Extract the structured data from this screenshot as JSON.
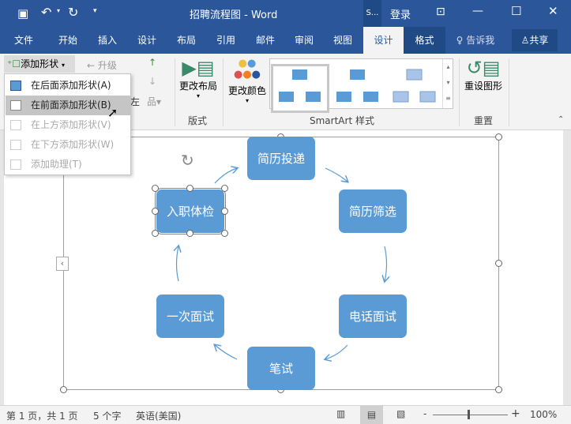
{
  "titlebar": {
    "title": "招聘流程图  -  Word",
    "account_short": "S...",
    "login": "登录",
    "qat_icons": [
      "save-icon",
      "undo-icon",
      "redo-icon",
      "customize-icon"
    ]
  },
  "tabs": [
    {
      "label": "文件"
    },
    {
      "label": "开始"
    },
    {
      "label": "插入"
    },
    {
      "label": "设计"
    },
    {
      "label": "布局"
    },
    {
      "label": "引用"
    },
    {
      "label": "邮件"
    },
    {
      "label": "审阅"
    },
    {
      "label": "视图"
    },
    {
      "label": "设计",
      "active": true
    },
    {
      "label": "格式"
    }
  ],
  "tell_me": "告诉我",
  "share": "共享",
  "ribbon": {
    "add_shape": "添加形状",
    "promote": "升级",
    "rtl_partial": "左",
    "change_layout": "更改布局",
    "change_colors": "更改颜色",
    "reset_graphic": "重设图形",
    "groups": {
      "layouts": "版式",
      "styles": "SmartArt 样式",
      "reset": "重置"
    }
  },
  "menu": [
    {
      "label": "在后面添加形状(A)",
      "enabled": true
    },
    {
      "label": "在前面添加形状(B)",
      "enabled": true,
      "highlighted": true
    },
    {
      "label": "在上方添加形状(V)",
      "enabled": false
    },
    {
      "label": "在下方添加形状(W)",
      "enabled": false
    },
    {
      "label": "添加助理(T)",
      "enabled": false
    }
  ],
  "smartart": {
    "color": "#5b9bd5",
    "nodes": [
      "简历投递",
      "简历筛选",
      "电话面试",
      "笔试",
      "一次面试",
      "入职体检"
    ],
    "selected": "入职体检"
  },
  "status": {
    "page": "第 1 页，共 1 页",
    "words": "5 个字",
    "lang": "英语(美国)",
    "zoom": "100%",
    "zoom_minus": "-",
    "zoom_plus": "+"
  },
  "colors": {
    "brand": "#2b579a",
    "active_tab": "#f3f3f3"
  }
}
